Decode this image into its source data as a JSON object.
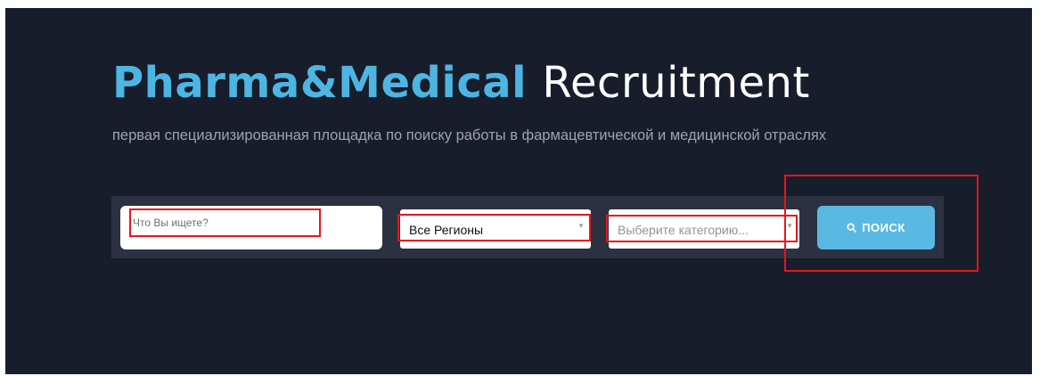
{
  "hero": {
    "title_brand": "Pharma&Medical",
    "title_rest": "Recruitment",
    "subtitle": "первая специализированная площадка по поиску работы в фармацевтической и медицинской отраслях"
  },
  "search": {
    "query_placeholder": "Что Вы ищете?",
    "region_value": "Все Регионы",
    "category_placeholder": "Выберите категорию...",
    "button_label": "ПОИСК",
    "button_icon": "search-icon"
  },
  "colors": {
    "background": "#181d2b",
    "brand_accent": "#4cb6e3",
    "button": "#5ab9e3",
    "annotation": "#e8141b"
  }
}
